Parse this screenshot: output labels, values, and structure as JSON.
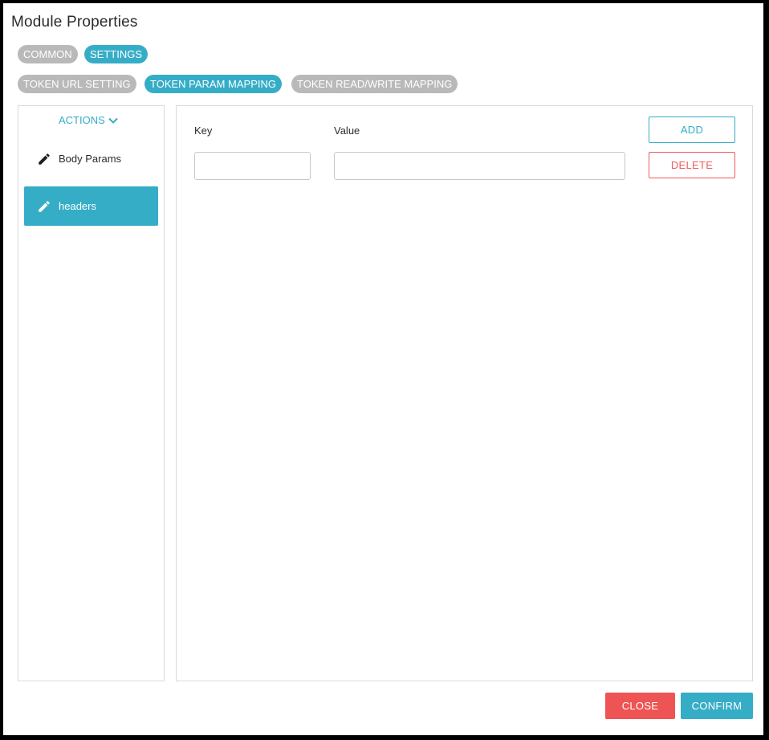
{
  "dialog": {
    "title": "Module Properties"
  },
  "tabs_primary": [
    {
      "label": "COMMON",
      "active": false
    },
    {
      "label": "SETTINGS",
      "active": true
    }
  ],
  "tabs_secondary": [
    {
      "label": "TOKEN URL SETTING",
      "active": false
    },
    {
      "label": "TOKEN PARAM MAPPING",
      "active": true
    },
    {
      "label": "TOKEN READ/WRITE MAPPING",
      "active": false
    }
  ],
  "actions": {
    "toggle_label": "ACTIONS",
    "items": [
      {
        "label": "Body Params",
        "icon": "pencil-icon",
        "selected": false
      },
      {
        "label": "headers",
        "icon": "pencil-icon",
        "selected": true
      }
    ]
  },
  "mapping": {
    "key_label": "Key",
    "value_label": "Value",
    "key_value": "",
    "value_value": "",
    "add_label": "ADD",
    "delete_label": "DELETE"
  },
  "footer": {
    "close_label": "CLOSE",
    "confirm_label": "CONFIRM"
  },
  "colors": {
    "accent": "#36adc7",
    "danger": "#ef5454",
    "inactive_pill": "#b9b9b9"
  }
}
